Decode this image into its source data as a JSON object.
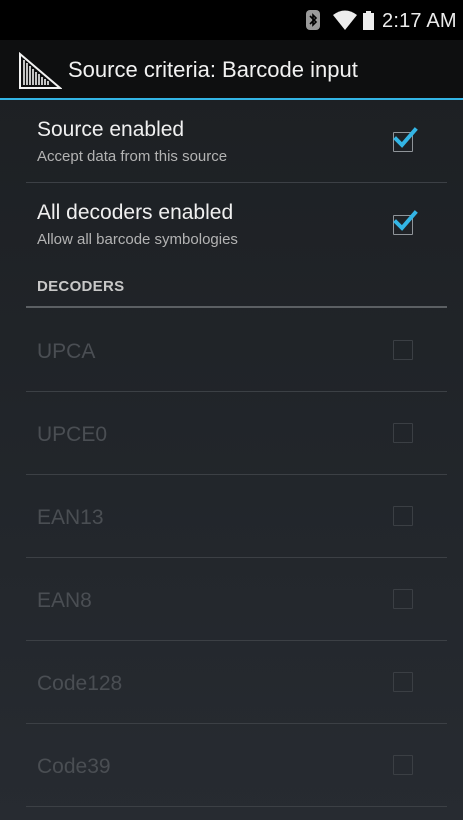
{
  "status_bar": {
    "time": "2:17 AM",
    "icons": [
      "bluetooth-icon",
      "wifi-icon",
      "battery-icon"
    ]
  },
  "action_bar": {
    "icon": "barcode-icon",
    "title": "Source criteria: Barcode input"
  },
  "preferences": [
    {
      "title": "Source enabled",
      "summary": "Accept data from this source",
      "checked": true
    },
    {
      "title": "All decoders enabled",
      "summary": "Allow all barcode symbologies",
      "checked": true
    }
  ],
  "section_header": "DECODERS",
  "decoders": [
    {
      "label": "UPCA",
      "checked": false,
      "enabled": false
    },
    {
      "label": "UPCE0",
      "checked": false,
      "enabled": false
    },
    {
      "label": "EAN13",
      "checked": false,
      "enabled": false
    },
    {
      "label": "EAN8",
      "checked": false,
      "enabled": false
    },
    {
      "label": "Code128",
      "checked": false,
      "enabled": false
    },
    {
      "label": "Code39",
      "checked": false,
      "enabled": false
    }
  ],
  "colors": {
    "accent": "#33b5e5",
    "background": "#22262b",
    "action_bar": "#0e0f10"
  }
}
